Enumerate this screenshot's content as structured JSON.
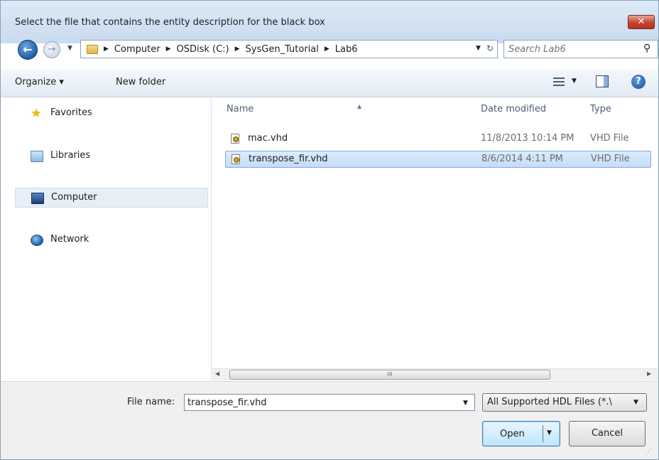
{
  "window": {
    "title": "Select the file that contains the entity description for the black box",
    "close_label": "✕"
  },
  "address": {
    "back_icon": "back-arrow-icon",
    "forward_icon": "forward-arrow-icon",
    "crumbs": [
      "Computer",
      "OSDisk (C:)",
      "SysGen_Tutorial",
      "Lab6"
    ],
    "crumb_separator": "▶",
    "dropdown_glyph": "▼"
  },
  "search": {
    "placeholder": "Search Lab6"
  },
  "toolbar": {
    "organize_label": "Organize ▾",
    "new_folder_label": "New folder",
    "view_dropdown": "▼"
  },
  "navpane": {
    "items": [
      {
        "label": "Favorites",
        "icon": "star-icon"
      },
      {
        "label": "Libraries",
        "icon": "libraries-icon"
      },
      {
        "label": "Computer",
        "icon": "computer-icon"
      },
      {
        "label": "Network",
        "icon": "network-icon"
      }
    ]
  },
  "filelist": {
    "columns": {
      "name": "Name",
      "date": "Date modified",
      "type": "Type"
    },
    "files": [
      {
        "name": "mac.vhd",
        "date": "11/8/2013 10:14 PM",
        "type": "VHD File"
      },
      {
        "name": "transpose_fir.vhd",
        "date": "8/6/2014 4:11 PM",
        "type": "VHD File"
      }
    ],
    "selected_index": 1
  },
  "bottom": {
    "file_name_label": "File name:",
    "file_name_value": "transpose_fir.vhd",
    "file_type_value": "All Supported HDL Files (*.\\",
    "open_label": "Open",
    "cancel_label": "Cancel"
  },
  "colors": {
    "selection": "#c4dcf8",
    "close_button": "#c6432b",
    "accent": "#1d5fa8"
  }
}
